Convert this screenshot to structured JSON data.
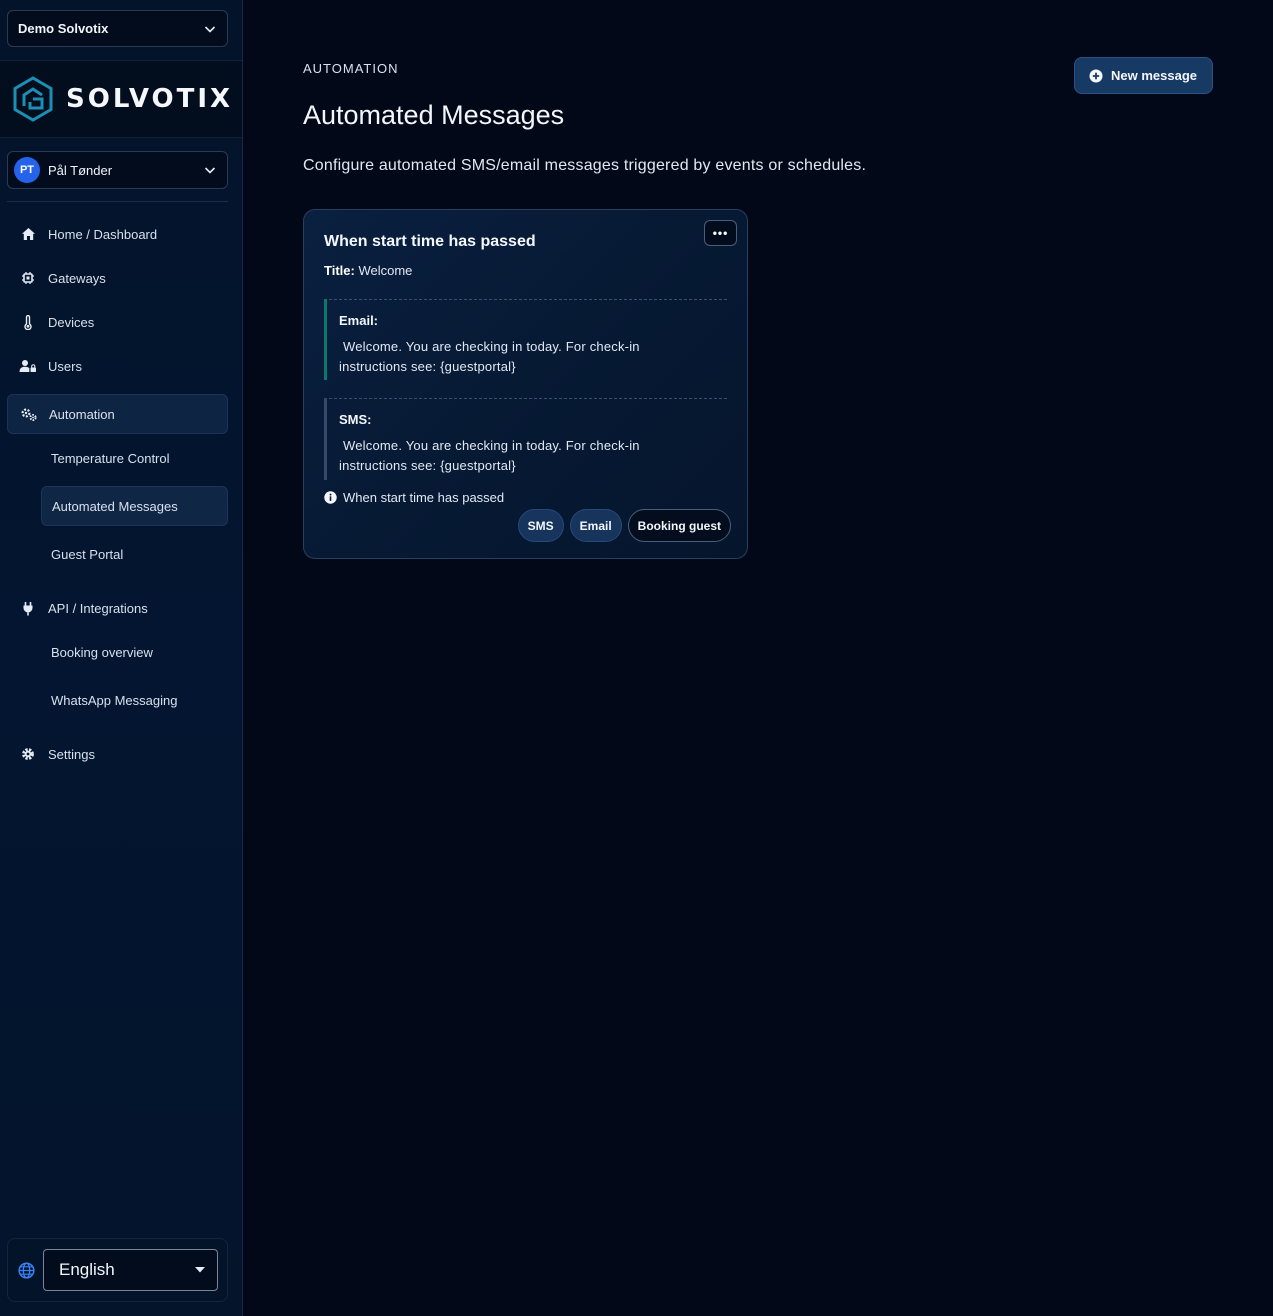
{
  "sidebar": {
    "org_select": "Demo Solvotix",
    "logo_text": "SOLVOTIX",
    "user": {
      "initials": "PT",
      "name": "Pål Tønder"
    },
    "nav": {
      "home": "Home / Dashboard",
      "gateways": "Gateways",
      "devices": "Devices",
      "users": "Users",
      "automation": "Automation",
      "temperature_control": "Temperature Control",
      "automated_messages": "Automated Messages",
      "guest_portal": "Guest Portal",
      "api": "API / Integrations",
      "booking_overview": "Booking overview",
      "whatsapp": "WhatsApp Messaging",
      "settings": "Settings"
    },
    "language": "English"
  },
  "main": {
    "breadcrumb": "AUTOMATION",
    "title": "Automated Messages",
    "description": "Configure automated SMS/email messages triggered by events or schedules.",
    "new_button": "New message",
    "card": {
      "menu": "•••",
      "title": "When start time has passed",
      "subtitle_label": "Title:",
      "subtitle_value": "Welcome",
      "email_label": "Email:",
      "email_line1": "Welcome. You are checking in today. For check-in",
      "email_line2": "instructions see: {guestportal}",
      "sms_label": "SMS:",
      "sms_line1": "Welcome. You are checking in today. For check-in",
      "sms_line2": "instructions see: {guestportal}",
      "trigger": "When start time has passed",
      "chips": [
        "SMS",
        "Email",
        "Booking guest"
      ]
    }
  }
}
